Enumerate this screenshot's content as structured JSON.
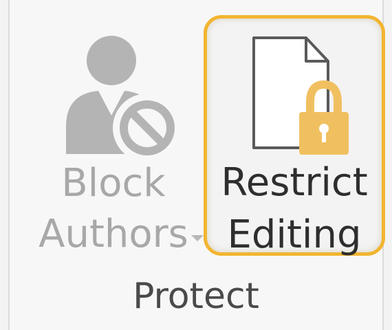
{
  "ribbon_group": {
    "label": "Protect",
    "buttons": {
      "block_authors": {
        "label_line1": "Block",
        "label_line2": "Authors",
        "enabled": false,
        "has_dropdown": true,
        "icon": "block-authors-icon"
      },
      "restrict_editing": {
        "label_line1": "Restrict",
        "label_line2": "Editing",
        "enabled": true,
        "highlighted": true,
        "icon": "document-lock-icon"
      }
    }
  },
  "colors": {
    "highlight": "#f2b531",
    "lock": "#f0c060",
    "disabled_text": "#a8a8a8",
    "enabled_text": "#2e2e2e"
  }
}
